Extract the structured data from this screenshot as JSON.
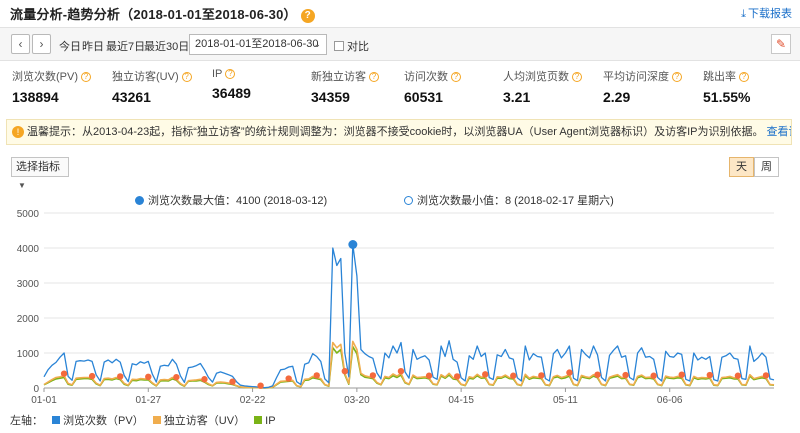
{
  "header": {
    "title": "流量分析-趋势分析（2018-01-01至2018-06-30）",
    "help_icon": "?",
    "download_icon": "download-icon",
    "download_label": "下载报表"
  },
  "toolbar": {
    "prev_icon": "‹",
    "next_icon": "›",
    "today": "今日",
    "yesterday": "昨日",
    "last7": "最近7日",
    "last30": "最近30日",
    "date_range": "2018-01-01至2018-06-30",
    "compare_label": "对比",
    "pin_icon": "pin-icon"
  },
  "metrics": [
    {
      "label": "浏览次数(PV)",
      "value": "138894"
    },
    {
      "label": "独立访客(UV)",
      "value": "43261"
    },
    {
      "label": "IP",
      "value": "36489"
    },
    {
      "label": "新独立访客",
      "value": "34359"
    },
    {
      "label": "访问次数",
      "value": "60531"
    },
    {
      "label": "人均浏览页数",
      "value": "3.21"
    },
    {
      "label": "平均访问深度",
      "value": "2.29"
    },
    {
      "label": "跳出率",
      "value": "51.55%"
    }
  ],
  "notice": {
    "text": "温馨提示：从2013-04-23起，指标“独立访客”的统计规则调整为：浏览器不接受cookie时，以浏览器UA（User Agent浏览器标识）及访客IP为识别依据。",
    "more": "查看详情>>"
  },
  "controls": {
    "select_metric": "选择指标",
    "day": "天",
    "week": "周"
  },
  "chart_info": {
    "max_label": "浏览次数最大值：4100 (2018-03-12)",
    "min_label": "浏览次数最小值：8 (2018-02-17 星期六)"
  },
  "legend": {
    "prefix": "左轴：",
    "items": [
      "浏览次数（PV）",
      "独立访客（UV）",
      "IP"
    ]
  },
  "colors": {
    "pv": "#2a84d6",
    "uv": "#f0ad4e",
    "ip": "#7ab317",
    "weekend_marker": "#f46a3d"
  },
  "chart_data": {
    "type": "line",
    "ylim": [
      0,
      5000
    ],
    "yticks": [
      "0",
      "1000",
      "2000",
      "3000",
      "4000",
      "5000"
    ],
    "xtick_labels": [
      "01-01",
      "01-27",
      "02-22",
      "03-20",
      "04-15",
      "05-11",
      "06-06"
    ],
    "x_start": "2018-01-01",
    "x_end": "2018-06-30",
    "series": [
      {
        "name": "浏览次数（PV）",
        "values": [
          320,
          520,
          650,
          730,
          880,
          1000,
          330,
          220,
          760,
          780,
          770,
          800,
          760,
          380,
          200,
          740,
          800,
          720,
          820,
          740,
          360,
          180,
          690,
          660,
          750,
          710,
          760,
          400,
          170,
          620,
          650,
          630,
          820,
          680,
          350,
          160,
          580,
          600,
          640,
          700,
          520,
          300,
          170,
          420,
          460,
          420,
          380,
          330,
          180,
          80,
          60,
          50,
          40,
          30,
          12,
          8,
          20,
          60,
          300,
          520,
          540,
          600,
          620,
          180,
          100,
          680,
          720,
          980,
          900,
          760,
          260,
          150,
          4000,
          3500,
          3700,
          1000,
          320,
          4100,
          3200,
          1100,
          980,
          900,
          850,
          430,
          260,
          1000,
          860,
          1200,
          1000,
          1300,
          460,
          280,
          1100,
          820,
          880,
          920,
          800,
          310,
          250,
          1200,
          900,
          1350,
          820,
          740,
          290,
          200,
          920,
          820,
          1200,
          900,
          1000,
          300,
          240,
          950,
          900,
          1100,
          860,
          820,
          290,
          200,
          1200,
          800,
          980,
          900,
          880,
          270,
          200,
          980,
          1100,
          860,
          1000,
          1200,
          280,
          210,
          1100,
          960,
          860,
          1200,
          950,
          300,
          200,
          930,
          1080,
          1200,
          880,
          920,
          300,
          230,
          1000,
          1150,
          880,
          900,
          820,
          300,
          200,
          1050,
          900,
          880,
          1000,
          960,
          250,
          200,
          1000,
          800,
          880,
          820,
          900,
          240,
          200,
          880,
          920,
          1000,
          850,
          820,
          270,
          250,
          1200,
          760,
          860,
          1000,
          880,
          260,
          230
        ]
      },
      {
        "name": "独立访客（UV）",
        "values": [
          100,
          170,
          240,
          300,
          320,
          350,
          130,
          90,
          280,
          290,
          300,
          300,
          280,
          140,
          80,
          270,
          280,
          260,
          300,
          270,
          130,
          80,
          250,
          240,
          270,
          260,
          260,
          150,
          70,
          230,
          240,
          230,
          300,
          250,
          130,
          60,
          210,
          220,
          230,
          250,
          190,
          120,
          70,
          160,
          170,
          160,
          140,
          120,
          70,
          30,
          20,
          18,
          15,
          12,
          6,
          5,
          8,
          25,
          110,
          190,
          200,
          210,
          220,
          70,
          40,
          250,
          260,
          330,
          300,
          270,
          100,
          60,
          1300,
          1150,
          1250,
          420,
          130,
          1330,
          1100,
          420,
          350,
          320,
          300,
          160,
          100,
          330,
          300,
          400,
          340,
          420,
          170,
          110,
          370,
          300,
          310,
          320,
          290,
          120,
          100,
          380,
          310,
          420,
          290,
          270,
          110,
          80,
          320,
          290,
          390,
          310,
          330,
          110,
          90,
          320,
          310,
          370,
          300,
          290,
          110,
          80,
          390,
          280,
          330,
          310,
          300,
          100,
          80,
          320,
          360,
          300,
          330,
          380,
          110,
          80,
          360,
          320,
          300,
          380,
          320,
          110,
          80,
          310,
          350,
          380,
          300,
          310,
          110,
          90,
          330,
          370,
          300,
          310,
          290,
          110,
          80,
          340,
          310,
          300,
          330,
          320,
          100,
          80,
          330,
          280,
          300,
          290,
          310,
          90,
          80,
          300,
          310,
          330,
          290,
          290,
          100,
          90,
          380,
          270,
          300,
          330,
          300,
          100,
          90
        ]
      },
      {
        "name": "IP",
        "values": [
          90,
          150,
          210,
          260,
          280,
          300,
          110,
          80,
          250,
          260,
          270,
          270,
          250,
          120,
          70,
          240,
          250,
          230,
          270,
          240,
          110,
          70,
          220,
          210,
          240,
          230,
          230,
          130,
          60,
          200,
          210,
          200,
          260,
          220,
          110,
          50,
          190,
          200,
          200,
          220,
          170,
          100,
          60,
          140,
          150,
          140,
          120,
          100,
          60,
          25,
          18,
          15,
          12,
          10,
          5,
          4,
          7,
          20,
          95,
          170,
          180,
          190,
          200,
          60,
          35,
          220,
          230,
          290,
          270,
          240,
          90,
          50,
          1150,
          1000,
          1100,
          380,
          110,
          1180,
          980,
          380,
          310,
          290,
          270,
          140,
          90,
          290,
          270,
          350,
          300,
          370,
          150,
          100,
          330,
          270,
          280,
          290,
          260,
          110,
          90,
          340,
          280,
          370,
          260,
          240,
          100,
          70,
          280,
          260,
          350,
          280,
          290,
          100,
          80,
          280,
          280,
          330,
          270,
          260,
          100,
          70,
          350,
          250,
          290,
          280,
          270,
          90,
          70,
          290,
          320,
          270,
          290,
          340,
          100,
          70,
          320,
          290,
          270,
          340,
          290,
          100,
          70,
          280,
          310,
          340,
          270,
          280,
          100,
          80,
          290,
          330,
          270,
          280,
          260,
          100,
          70,
          300,
          280,
          270,
          290,
          280,
          90,
          70,
          290,
          250,
          270,
          260,
          280,
          80,
          70,
          270,
          280,
          290,
          260,
          260,
          90,
          80,
          340,
          240,
          270,
          290,
          270,
          90,
          80
        ]
      }
    ],
    "markers": {
      "max": {
        "date": "2018-03-12",
        "value": 4100
      },
      "min": {
        "date": "2018-02-17",
        "value": 8
      }
    },
    "grid": true,
    "legend_position": "bottom-left"
  }
}
